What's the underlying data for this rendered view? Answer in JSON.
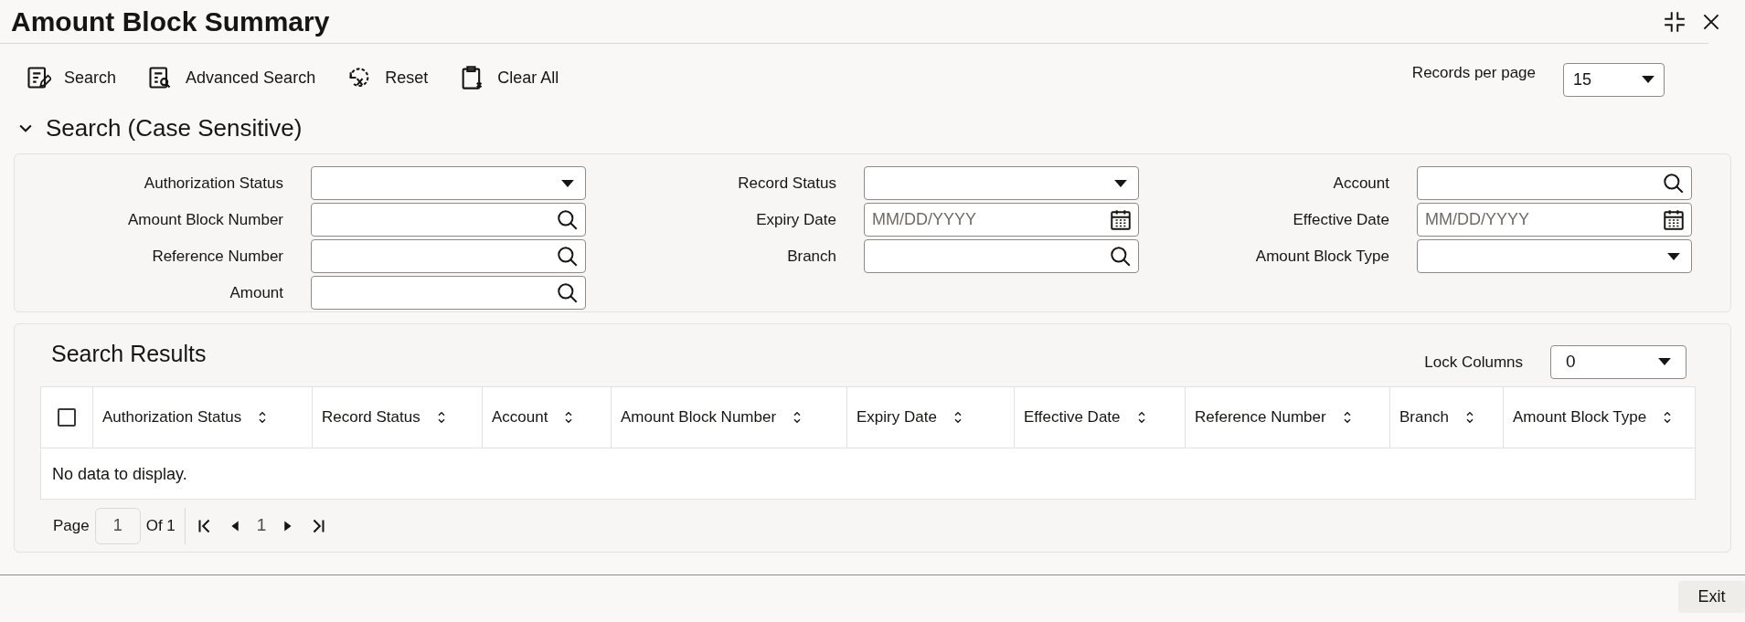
{
  "window": {
    "title": "Amount Block Summary"
  },
  "toolbar": [
    {
      "label": "Search",
      "kind": "search"
    },
    {
      "label": "Advanced Search",
      "kind": "advanced"
    },
    {
      "label": "Reset",
      "kind": "reset"
    },
    {
      "label": "Clear All",
      "kind": "clear"
    }
  ],
  "records_per_page": {
    "label": "Records per page",
    "value": "15"
  },
  "search_section": {
    "title": "Search (Case Sensitive)",
    "expanded": true,
    "columns": [
      [
        {
          "label": "Authorization Status",
          "kind": "select"
        },
        {
          "label": "Amount Block Number",
          "kind": "lookup"
        },
        {
          "label": "Reference Number",
          "kind": "lookup"
        },
        {
          "label": "Amount",
          "kind": "lookup"
        }
      ],
      [
        {
          "label": "Record Status",
          "kind": "select"
        },
        {
          "label": "Expiry Date",
          "kind": "date",
          "placeholder": "MM/DD/YYYY"
        },
        {
          "label": "Branch",
          "kind": "lookup"
        }
      ],
      [
        {
          "label": "Account",
          "kind": "lookup"
        },
        {
          "label": "Effective Date",
          "kind": "date",
          "placeholder": "MM/DD/YYYY"
        },
        {
          "label": "Amount Block Type",
          "kind": "select"
        }
      ]
    ]
  },
  "results": {
    "title": "Search Results",
    "lock_columns": {
      "label": "Lock Columns",
      "value": "0"
    },
    "select_all_checked": false,
    "columns": [
      "Authorization Status",
      "Record Status",
      "Account",
      "Amount Block Number",
      "Expiry Date",
      "Effective Date",
      "Reference Number",
      "Branch",
      "Amount Block Type"
    ],
    "empty_message": "No data to display.",
    "pagination": {
      "page_label": "Page",
      "page": "1",
      "of_label": "Of 1",
      "current": "1"
    }
  },
  "footer": {
    "exit": "Exit"
  }
}
